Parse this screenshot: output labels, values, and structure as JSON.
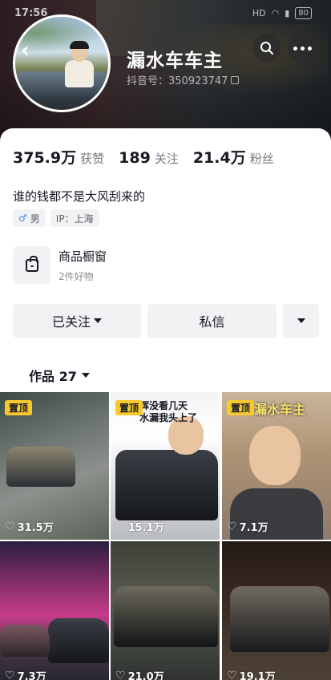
{
  "status_bar": {
    "time": "17:56",
    "network": "HD",
    "battery": "80"
  },
  "header": {
    "nickname": "漏水车车主",
    "douyin_id": "抖音号：350923747",
    "icons": [
      "back-icon",
      "search-icon",
      "more-icon",
      "copy-icon"
    ]
  },
  "stats": [
    {
      "value": "375.9万",
      "label": "获赞"
    },
    {
      "value": "189",
      "label": "关注"
    },
    {
      "value": "21.4万",
      "label": "粉丝"
    }
  ],
  "bio": "谁的钱都不是大风刮来的",
  "tags": {
    "gender": "男",
    "ip": "IP：上海"
  },
  "shop": {
    "title": "商品橱窗",
    "subtitle": "2件好物"
  },
  "actions": {
    "follow": "已关注",
    "message": "私信"
  },
  "works_tab": "作品 27",
  "videos": [
    {
      "pinned": "置顶",
      "likes": "31.5万",
      "caption": ""
    },
    {
      "pinned": "置顶",
      "likes": "15.1万",
      "caption": "辉没看几天\n水漏我头上了"
    },
    {
      "pinned": "置顶",
      "likes": "7.1万",
      "caption": "漏水车主"
    },
    {
      "pinned": "",
      "likes": "7.3万",
      "caption": ""
    },
    {
      "pinned": "",
      "likes": "21.0万",
      "caption": ""
    },
    {
      "pinned": "",
      "likes": "19.1万",
      "caption": ""
    }
  ],
  "colors": {
    "accent_pin": "#f7c92e",
    "text": "#161823",
    "muted": "#777a80",
    "button_bg": "#f2f2f4"
  }
}
